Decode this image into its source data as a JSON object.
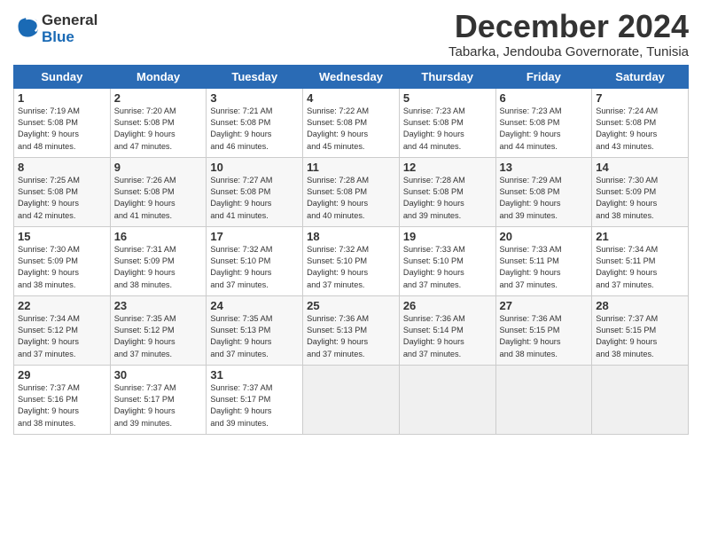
{
  "logo": {
    "line1": "General",
    "line2": "Blue"
  },
  "title": "December 2024",
  "location": "Tabarka, Jendouba Governorate, Tunisia",
  "headers": [
    "Sunday",
    "Monday",
    "Tuesday",
    "Wednesday",
    "Thursday",
    "Friday",
    "Saturday"
  ],
  "weeks": [
    [
      {
        "day": "1",
        "info": "Sunrise: 7:19 AM\nSunset: 5:08 PM\nDaylight: 9 hours\nand 48 minutes."
      },
      {
        "day": "2",
        "info": "Sunrise: 7:20 AM\nSunset: 5:08 PM\nDaylight: 9 hours\nand 47 minutes."
      },
      {
        "day": "3",
        "info": "Sunrise: 7:21 AM\nSunset: 5:08 PM\nDaylight: 9 hours\nand 46 minutes."
      },
      {
        "day": "4",
        "info": "Sunrise: 7:22 AM\nSunset: 5:08 PM\nDaylight: 9 hours\nand 45 minutes."
      },
      {
        "day": "5",
        "info": "Sunrise: 7:23 AM\nSunset: 5:08 PM\nDaylight: 9 hours\nand 44 minutes."
      },
      {
        "day": "6",
        "info": "Sunrise: 7:23 AM\nSunset: 5:08 PM\nDaylight: 9 hours\nand 44 minutes."
      },
      {
        "day": "7",
        "info": "Sunrise: 7:24 AM\nSunset: 5:08 PM\nDaylight: 9 hours\nand 43 minutes."
      }
    ],
    [
      {
        "day": "8",
        "info": "Sunrise: 7:25 AM\nSunset: 5:08 PM\nDaylight: 9 hours\nand 42 minutes."
      },
      {
        "day": "9",
        "info": "Sunrise: 7:26 AM\nSunset: 5:08 PM\nDaylight: 9 hours\nand 41 minutes."
      },
      {
        "day": "10",
        "info": "Sunrise: 7:27 AM\nSunset: 5:08 PM\nDaylight: 9 hours\nand 41 minutes."
      },
      {
        "day": "11",
        "info": "Sunrise: 7:28 AM\nSunset: 5:08 PM\nDaylight: 9 hours\nand 40 minutes."
      },
      {
        "day": "12",
        "info": "Sunrise: 7:28 AM\nSunset: 5:08 PM\nDaylight: 9 hours\nand 39 minutes."
      },
      {
        "day": "13",
        "info": "Sunrise: 7:29 AM\nSunset: 5:08 PM\nDaylight: 9 hours\nand 39 minutes."
      },
      {
        "day": "14",
        "info": "Sunrise: 7:30 AM\nSunset: 5:09 PM\nDaylight: 9 hours\nand 38 minutes."
      }
    ],
    [
      {
        "day": "15",
        "info": "Sunrise: 7:30 AM\nSunset: 5:09 PM\nDaylight: 9 hours\nand 38 minutes."
      },
      {
        "day": "16",
        "info": "Sunrise: 7:31 AM\nSunset: 5:09 PM\nDaylight: 9 hours\nand 38 minutes."
      },
      {
        "day": "17",
        "info": "Sunrise: 7:32 AM\nSunset: 5:10 PM\nDaylight: 9 hours\nand 37 minutes."
      },
      {
        "day": "18",
        "info": "Sunrise: 7:32 AM\nSunset: 5:10 PM\nDaylight: 9 hours\nand 37 minutes."
      },
      {
        "day": "19",
        "info": "Sunrise: 7:33 AM\nSunset: 5:10 PM\nDaylight: 9 hours\nand 37 minutes."
      },
      {
        "day": "20",
        "info": "Sunrise: 7:33 AM\nSunset: 5:11 PM\nDaylight: 9 hours\nand 37 minutes."
      },
      {
        "day": "21",
        "info": "Sunrise: 7:34 AM\nSunset: 5:11 PM\nDaylight: 9 hours\nand 37 minutes."
      }
    ],
    [
      {
        "day": "22",
        "info": "Sunrise: 7:34 AM\nSunset: 5:12 PM\nDaylight: 9 hours\nand 37 minutes."
      },
      {
        "day": "23",
        "info": "Sunrise: 7:35 AM\nSunset: 5:12 PM\nDaylight: 9 hours\nand 37 minutes."
      },
      {
        "day": "24",
        "info": "Sunrise: 7:35 AM\nSunset: 5:13 PM\nDaylight: 9 hours\nand 37 minutes."
      },
      {
        "day": "25",
        "info": "Sunrise: 7:36 AM\nSunset: 5:13 PM\nDaylight: 9 hours\nand 37 minutes."
      },
      {
        "day": "26",
        "info": "Sunrise: 7:36 AM\nSunset: 5:14 PM\nDaylight: 9 hours\nand 37 minutes."
      },
      {
        "day": "27",
        "info": "Sunrise: 7:36 AM\nSunset: 5:15 PM\nDaylight: 9 hours\nand 38 minutes."
      },
      {
        "day": "28",
        "info": "Sunrise: 7:37 AM\nSunset: 5:15 PM\nDaylight: 9 hours\nand 38 minutes."
      }
    ],
    [
      {
        "day": "29",
        "info": "Sunrise: 7:37 AM\nSunset: 5:16 PM\nDaylight: 9 hours\nand 38 minutes."
      },
      {
        "day": "30",
        "info": "Sunrise: 7:37 AM\nSunset: 5:17 PM\nDaylight: 9 hours\nand 39 minutes."
      },
      {
        "day": "31",
        "info": "Sunrise: 7:37 AM\nSunset: 5:17 PM\nDaylight: 9 hours\nand 39 minutes."
      },
      null,
      null,
      null,
      null
    ]
  ]
}
